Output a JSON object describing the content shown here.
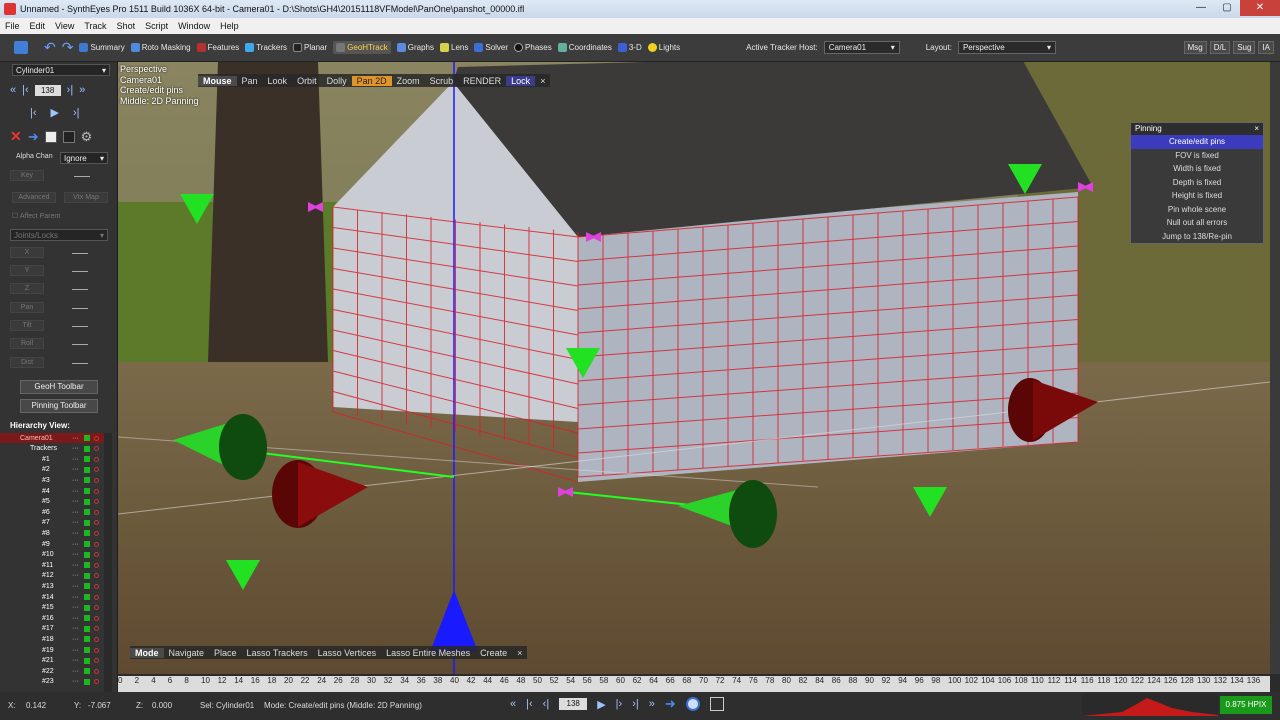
{
  "window": {
    "title": "Unnamed - SynthEyes Pro 1511 Build 1036X 64-bit - Camera01 - D:\\Shots\\GH4\\20151118VFModel\\PanOne\\panshot_00000.ifl",
    "minimize": "—",
    "maximize": "▢",
    "close": "✕"
  },
  "menu": [
    "File",
    "Edit",
    "View",
    "Track",
    "Shot",
    "Script",
    "Window",
    "Help"
  ],
  "toolbar": {
    "rooms": [
      "Summary",
      "Roto Masking",
      "Features",
      "Trackers",
      "Planar",
      "GeoHTrack",
      "Graphs",
      "Lens",
      "Solver",
      "Phases",
      "Coordinates",
      "3-D",
      "Lights"
    ],
    "active_room": "GeoHTrack",
    "active_tracker_host_label": "Active Tracker Host:",
    "active_tracker_host_value": "Camera01",
    "layout_label": "Layout:",
    "layout_value": "Perspective",
    "right_buttons": [
      "Msg",
      "D/L",
      "Sug",
      "IA"
    ]
  },
  "left": {
    "object_select": "Cylinder01",
    "frame": "138",
    "alpha_chan_label": "Alpha Chan",
    "alpha_chan_value": "Ignore",
    "key": "Key",
    "advanced": "Advanced",
    "vtx_map": "Vtx Map",
    "affect_parent": "Affect Parent",
    "joints_locks": "Joints/Locks",
    "channels": [
      "X",
      "Y",
      "Z",
      "Pan",
      "Tilt",
      "Roll",
      "Dist"
    ],
    "geoh_toolbar": "GeoH Toolbar",
    "pinning_toolbar": "Pinning Toolbar",
    "hierarchy_title": "Hierarchy View:",
    "camera": "Camera01",
    "trackers_label": "Trackers",
    "trackers": [
      "#1",
      "#2",
      "#3",
      "#4",
      "#5",
      "#6",
      "#7",
      "#8",
      "#9",
      "#10",
      "#11",
      "#12",
      "#13",
      "#14",
      "#15",
      "#16",
      "#17",
      "#18",
      "#19",
      "#21",
      "#22",
      "#23"
    ],
    "row_dots": "···"
  },
  "viewport": {
    "info": [
      "Perspective",
      "Camera01",
      "Create/edit pins",
      "Middle: 2D Panning"
    ],
    "top_modes": [
      "Mouse",
      "Pan",
      "Look",
      "Orbit",
      "Dolly",
      "Pan 2D",
      "Zoom",
      "Scrub",
      "RENDER",
      "Lock"
    ],
    "top_active": "Pan 2D",
    "bottom_modes": [
      "Mode",
      "Navigate",
      "Place",
      "Lasso Trackers",
      "Lasso Vertices",
      "Lasso Entire Meshes",
      "Create"
    ],
    "close": "×"
  },
  "pinning": {
    "title": "Pinning",
    "close": "×",
    "items": [
      "Create/edit pins",
      "FOV is fixed",
      "Width is fixed",
      "Depth is fixed",
      "Height is fixed",
      "Pin whole scene",
      "Null out all errors",
      "Jump to 138/Re-pin"
    ],
    "selected": "Create/edit pins"
  },
  "timeline": {
    "ticks": [
      "0",
      "2",
      "4",
      "6",
      "8",
      "10",
      "12",
      "14",
      "16",
      "18",
      "20",
      "22",
      "24",
      "26",
      "28",
      "30",
      "32",
      "34",
      "36",
      "38",
      "40",
      "42",
      "44",
      "46",
      "48",
      "50",
      "52",
      "54",
      "56",
      "58",
      "60",
      "62",
      "64",
      "66",
      "68",
      "70",
      "72",
      "74",
      "76",
      "78",
      "80",
      "82",
      "84",
      "86",
      "88",
      "90",
      "92",
      "94",
      "96",
      "98",
      "100",
      "102",
      "104",
      "106",
      "108",
      "110",
      "112",
      "114",
      "116",
      "118",
      "120",
      "122",
      "124",
      "126",
      "128",
      "130",
      "132",
      "134",
      "136"
    ]
  },
  "status": {
    "x_label": "X:",
    "x": "0.142",
    "y_label": "Y:",
    "y": "-7.067",
    "z_label": "Z:",
    "z": "0.000",
    "sel": "Sel: Cylinder01",
    "mode": "Mode: Create/edit pins (Middle: 2D Panning)",
    "frame": "138",
    "hpix": "0.875 HPIX"
  },
  "colors": {
    "accent": "#e0952a",
    "selected": "#3b3bbd",
    "tracker_green": "#1ee01e",
    "cone_red": "#6b0a0a",
    "grid_red": "#d8202a",
    "axis_blue": "#1a1aff"
  }
}
